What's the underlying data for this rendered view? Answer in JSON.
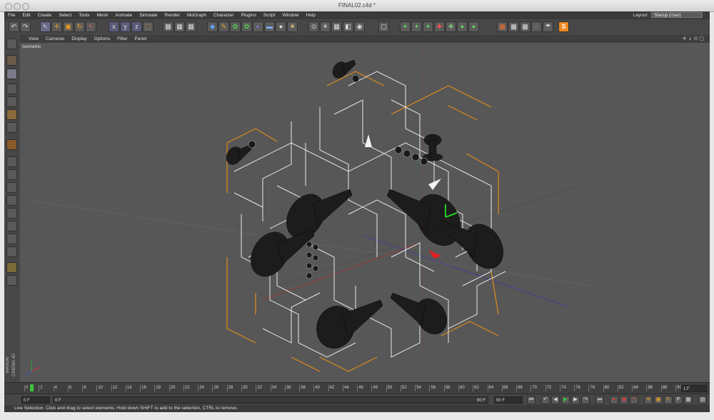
{
  "window": {
    "title": "FINAL02.c4d *"
  },
  "menubar": {
    "items": [
      "File",
      "Edit",
      "Create",
      "Select",
      "Tools",
      "Mesh",
      "Animate",
      "Simulate",
      "Render",
      "MoGraph",
      "Character",
      "Plugins",
      "Script",
      "Window",
      "Help"
    ],
    "layout_label": "Layout:",
    "layout_value": "Startup (User)"
  },
  "viewport": {
    "menu": [
      "View",
      "Cameras",
      "Display",
      "Options",
      "Filter",
      "Panel"
    ],
    "label": "Isometric"
  },
  "left_tools": {
    "brand": "MAXON CINEMA 4D"
  },
  "timeline": {
    "ticks": [
      "0",
      "2",
      "4",
      "6",
      "8",
      "10",
      "12",
      "14",
      "16",
      "18",
      "20",
      "22",
      "24",
      "26",
      "28",
      "30",
      "32",
      "34",
      "36",
      "38",
      "40",
      "42",
      "44",
      "46",
      "48",
      "50",
      "52",
      "54",
      "56",
      "58",
      "60",
      "62",
      "64",
      "66",
      "68",
      "70",
      "72",
      "74",
      "76",
      "78",
      "80",
      "82",
      "84",
      "86",
      "88",
      "90"
    ],
    "current_frame": "1 F"
  },
  "controls": {
    "start_frame": "0 F",
    "min_frame": "0 F",
    "max_frame": "90 F",
    "end_frame": "90 F"
  },
  "status": {
    "text": "Live Selection: Click and drag to select elements. Hold down SHIFT to add to the selection, CTRL to remove."
  },
  "colors": {
    "accent": "#e88a1a",
    "viewport_bg": "#575757",
    "x_axis": "#e02020",
    "y_axis": "#20c020",
    "z_axis": "#3030c0"
  }
}
